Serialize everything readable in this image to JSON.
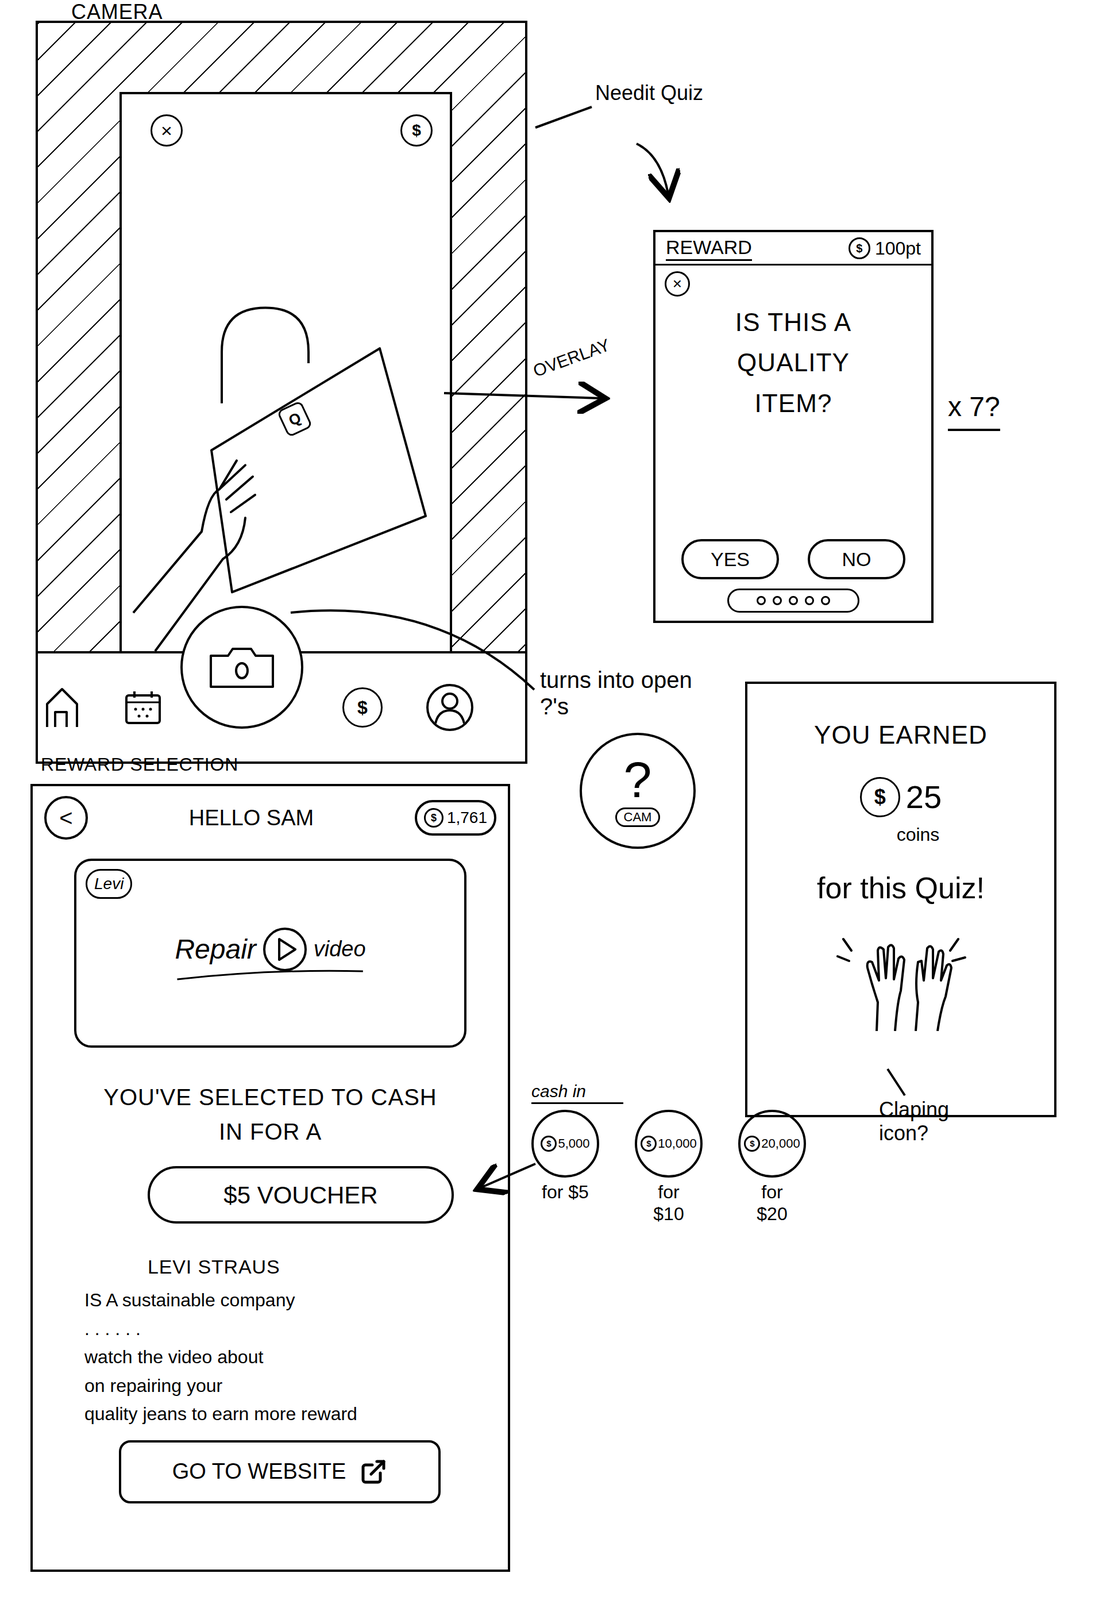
{
  "labels": {
    "camera": "CAMERA",
    "needit": "Needit Quiz",
    "overlay": "OVERLAY",
    "repeat": "x 7?",
    "turns": "turns into open ?'s",
    "clapping": "Claping icon?",
    "reward_selection": "REWARD SELECTION"
  },
  "camera_screen": {
    "close": "×",
    "coin": "$",
    "tag": "Q",
    "nav": [
      {
        "kind": "home",
        "text": ""
      },
      {
        "kind": "calendar",
        "text": ""
      },
      {
        "kind": "coin",
        "text": "$"
      },
      {
        "kind": "profile",
        "text": ""
      }
    ]
  },
  "quiz": {
    "title": "REWARD",
    "coin": "$",
    "points": "100pt",
    "close": "×",
    "question": "IS THIS A QUALITY ITEM?",
    "answers": [
      "YES",
      "NO"
    ],
    "progress": [
      false,
      false,
      false,
      false,
      false
    ]
  },
  "question_button": {
    "symbol": "?",
    "label": "CAM"
  },
  "earned": {
    "heading": "YOU EARNED",
    "coin": "$",
    "amount": "25",
    "unit": "coins",
    "message": "for this Quiz!"
  },
  "reward_selection": {
    "back": "<",
    "greeting": "HELLO SAM",
    "coin": "$",
    "balance": "1,761",
    "video": {
      "brand": "Levi",
      "before": "Repair",
      "after": "video"
    },
    "selected_text": "YOU'VE SELECTED TO CASH IN FOR A",
    "voucher": "$5 VOUCHER",
    "company": "LEVI STRAUS",
    "description": [
      "IS A sustainable company",
      ". . . . . .",
      "watch the video about",
      "on repairing your",
      "quality jeans to earn more reward"
    ],
    "button": "GO TO WEBSITE"
  },
  "cash_in": {
    "title": "cash in",
    "options": [
      {
        "coin": "$",
        "amount": "5,000",
        "price": "for $5"
      },
      {
        "coin": "$",
        "amount": "10,000",
        "price": "for $10"
      },
      {
        "coin": "$",
        "amount": "20,000",
        "price": "for $20"
      }
    ]
  }
}
